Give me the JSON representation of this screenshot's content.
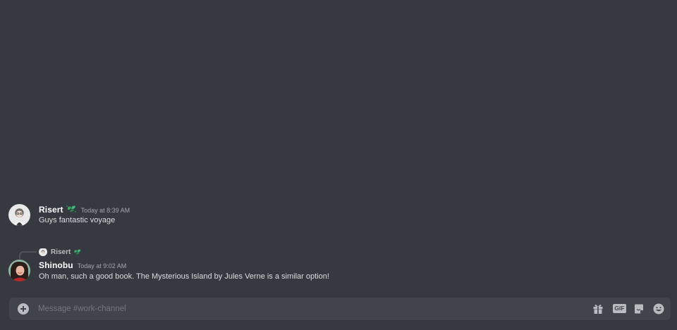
{
  "messages": [
    {
      "author": "Risert",
      "badge_icon": "leaf-badge-icon",
      "timestamp": "Today at 8:39 AM",
      "content": "Guys fantastic voyage"
    },
    {
      "reply_to": {
        "author": "Risert",
        "badge_icon": "leaf-badge-icon"
      },
      "author": "Shinobu",
      "timestamp": "Today at 9:02 AM",
      "content": "Oh man, such a good book. The Mysterious Island by Jules Verne is a similar option!"
    }
  ],
  "composer": {
    "placeholder": "Message #work-channel",
    "value": "",
    "gif_label": "GIF",
    "icons": [
      "add-icon",
      "gift-icon",
      "gif-icon",
      "sticker-icon",
      "emoji-icon"
    ]
  },
  "colors": {
    "background": "#36393f",
    "composer_bg": "#40444b",
    "badge_green": "#3ba55d",
    "author": "#ffffff",
    "text": "#dcddde",
    "muted": "#a3a6aa"
  }
}
